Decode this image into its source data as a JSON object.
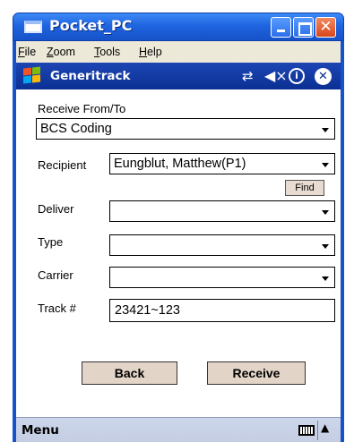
{
  "window": {
    "title": "Pocket_PC",
    "close_glyph": "✕"
  },
  "menubar": {
    "items": [
      "File",
      "Zoom",
      "Tools",
      "Help"
    ]
  },
  "device_titlebar": {
    "title": "Generitrack",
    "icons": [
      "windows-flag-icon",
      "connectivity-icon",
      "volume-mute-icon",
      "info-icon",
      "close-icon"
    ],
    "connect_glyph": "⇄",
    "volume_glyph": "◀×",
    "info_glyph": "i",
    "close_glyph": "✕"
  },
  "form": {
    "receive_from_to": {
      "label": "Receive From/To",
      "value": "BCS Coding"
    },
    "recipient": {
      "label": "Recipient",
      "value": "Eungblut, Matthew(P1)"
    },
    "find_label": "Find",
    "deliver": {
      "label": "Deliver",
      "value": ""
    },
    "type": {
      "label": "Type",
      "value": ""
    },
    "carrier": {
      "label": "Carrier",
      "value": ""
    },
    "track": {
      "label": "Track #",
      "value": "23421~123"
    },
    "back_label": "Back",
    "receive_label": "Receive"
  },
  "bottom_bar": {
    "menu_label": "Menu",
    "sip_arrow": "▲"
  },
  "colors": {
    "xp_title_blue": "#1f64e0",
    "device_title_blue": "#0b2f93",
    "button_face": "#e3d4c8",
    "bottom_bar": "#c4cde2"
  }
}
